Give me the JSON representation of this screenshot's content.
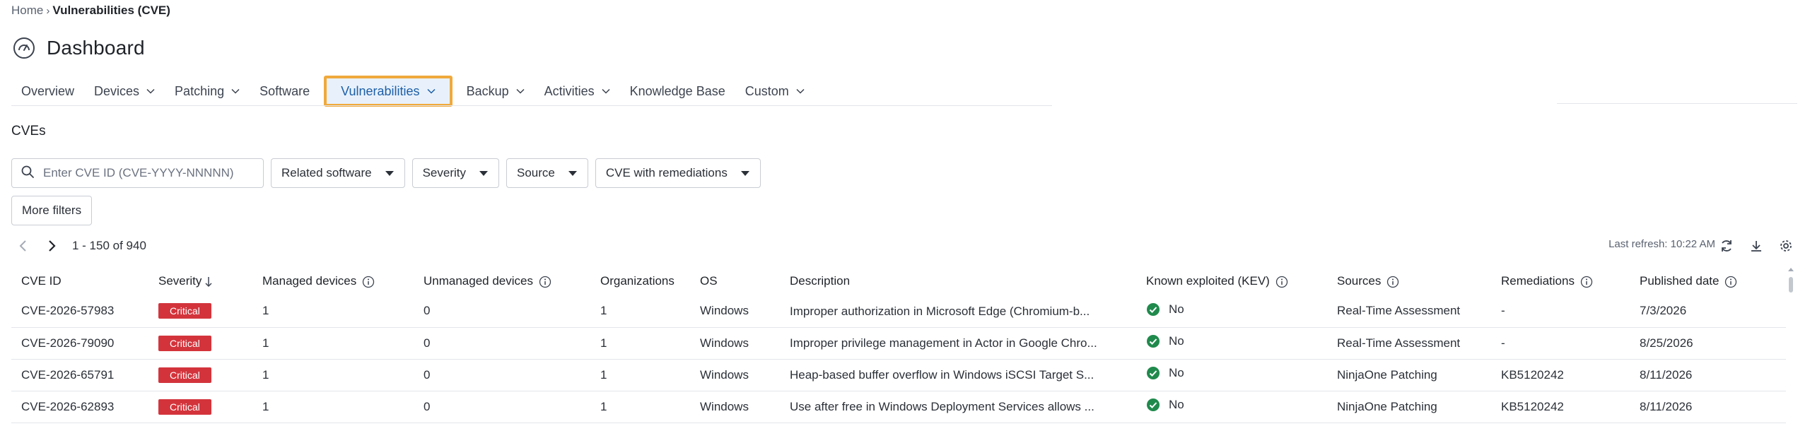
{
  "breadcrumb": {
    "home": "Home",
    "current": "Vulnerabilities (CVE)"
  },
  "page": {
    "title": "Dashboard"
  },
  "tabs": [
    {
      "label": "Overview",
      "dropdown": false
    },
    {
      "label": "Devices",
      "dropdown": true
    },
    {
      "label": "Patching",
      "dropdown": true
    },
    {
      "label": "Software",
      "dropdown": false
    },
    {
      "label": "Vulnerabilities",
      "dropdown": true,
      "active": true
    },
    {
      "label": "Backup",
      "dropdown": true
    },
    {
      "label": "Activities",
      "dropdown": true
    },
    {
      "label": "Knowledge Base",
      "dropdown": false
    },
    {
      "label": "Custom",
      "dropdown": true
    }
  ],
  "section": {
    "title": "CVEs"
  },
  "filters": {
    "search_placeholder": "Enter CVE ID (CVE-YYYY-NNNNN)",
    "related_software": "Related software",
    "severity": "Severity",
    "source": "Source",
    "remediations": "CVE with remediations",
    "more": "More filters"
  },
  "pager": {
    "range": "1 - 150 of 940"
  },
  "refresh": {
    "text": "Last refresh: 10:22 AM"
  },
  "table": {
    "headers": {
      "cve_id": "CVE ID",
      "severity": "Severity",
      "managed": "Managed devices",
      "unmanaged": "Unmanaged devices",
      "organizations": "Organizations",
      "os": "OS",
      "description": "Description",
      "kev": "Known exploited (KEV)",
      "sources": "Sources",
      "remediations": "Remediations",
      "published": "Published date"
    },
    "rows": [
      {
        "cve_id": "CVE-2026-57983",
        "severity": "Critical",
        "managed": "1",
        "unmanaged": "0",
        "organizations": "1",
        "os": "Windows",
        "description": "Improper authorization in Microsoft Edge (Chromium-b...",
        "kev": "No",
        "sources": "Real-Time Assessment",
        "remediations": "-",
        "published": "7/3/2026"
      },
      {
        "cve_id": "CVE-2026-79090",
        "severity": "Critical",
        "managed": "1",
        "unmanaged": "0",
        "organizations": "1",
        "os": "Windows",
        "description": "Improper privilege management in Actor in Google Chro...",
        "kev": "No",
        "sources": "Real-Time Assessment",
        "remediations": "-",
        "published": "8/25/2026"
      },
      {
        "cve_id": "CVE-2026-65791",
        "severity": "Critical",
        "managed": "1",
        "unmanaged": "0",
        "organizations": "1",
        "os": "Windows",
        "description": "Heap-based buffer overflow in Windows iSCSI Target S...",
        "kev": "No",
        "sources": "NinjaOne Patching",
        "remediations": "KB5120242",
        "published": "8/11/2026"
      },
      {
        "cve_id": "CVE-2026-62893",
        "severity": "Critical",
        "managed": "1",
        "unmanaged": "0",
        "organizations": "1",
        "os": "Windows",
        "description": "Use after free in Windows Deployment Services allows ...",
        "kev": "No",
        "sources": "NinjaOne Patching",
        "remediations": "KB5120242",
        "published": "8/11/2026"
      }
    ]
  },
  "colors": {
    "accent": "#1d5fa8",
    "critical": "#d3343c",
    "success": "#1f8a4c",
    "highlight": "#f0a93c"
  }
}
